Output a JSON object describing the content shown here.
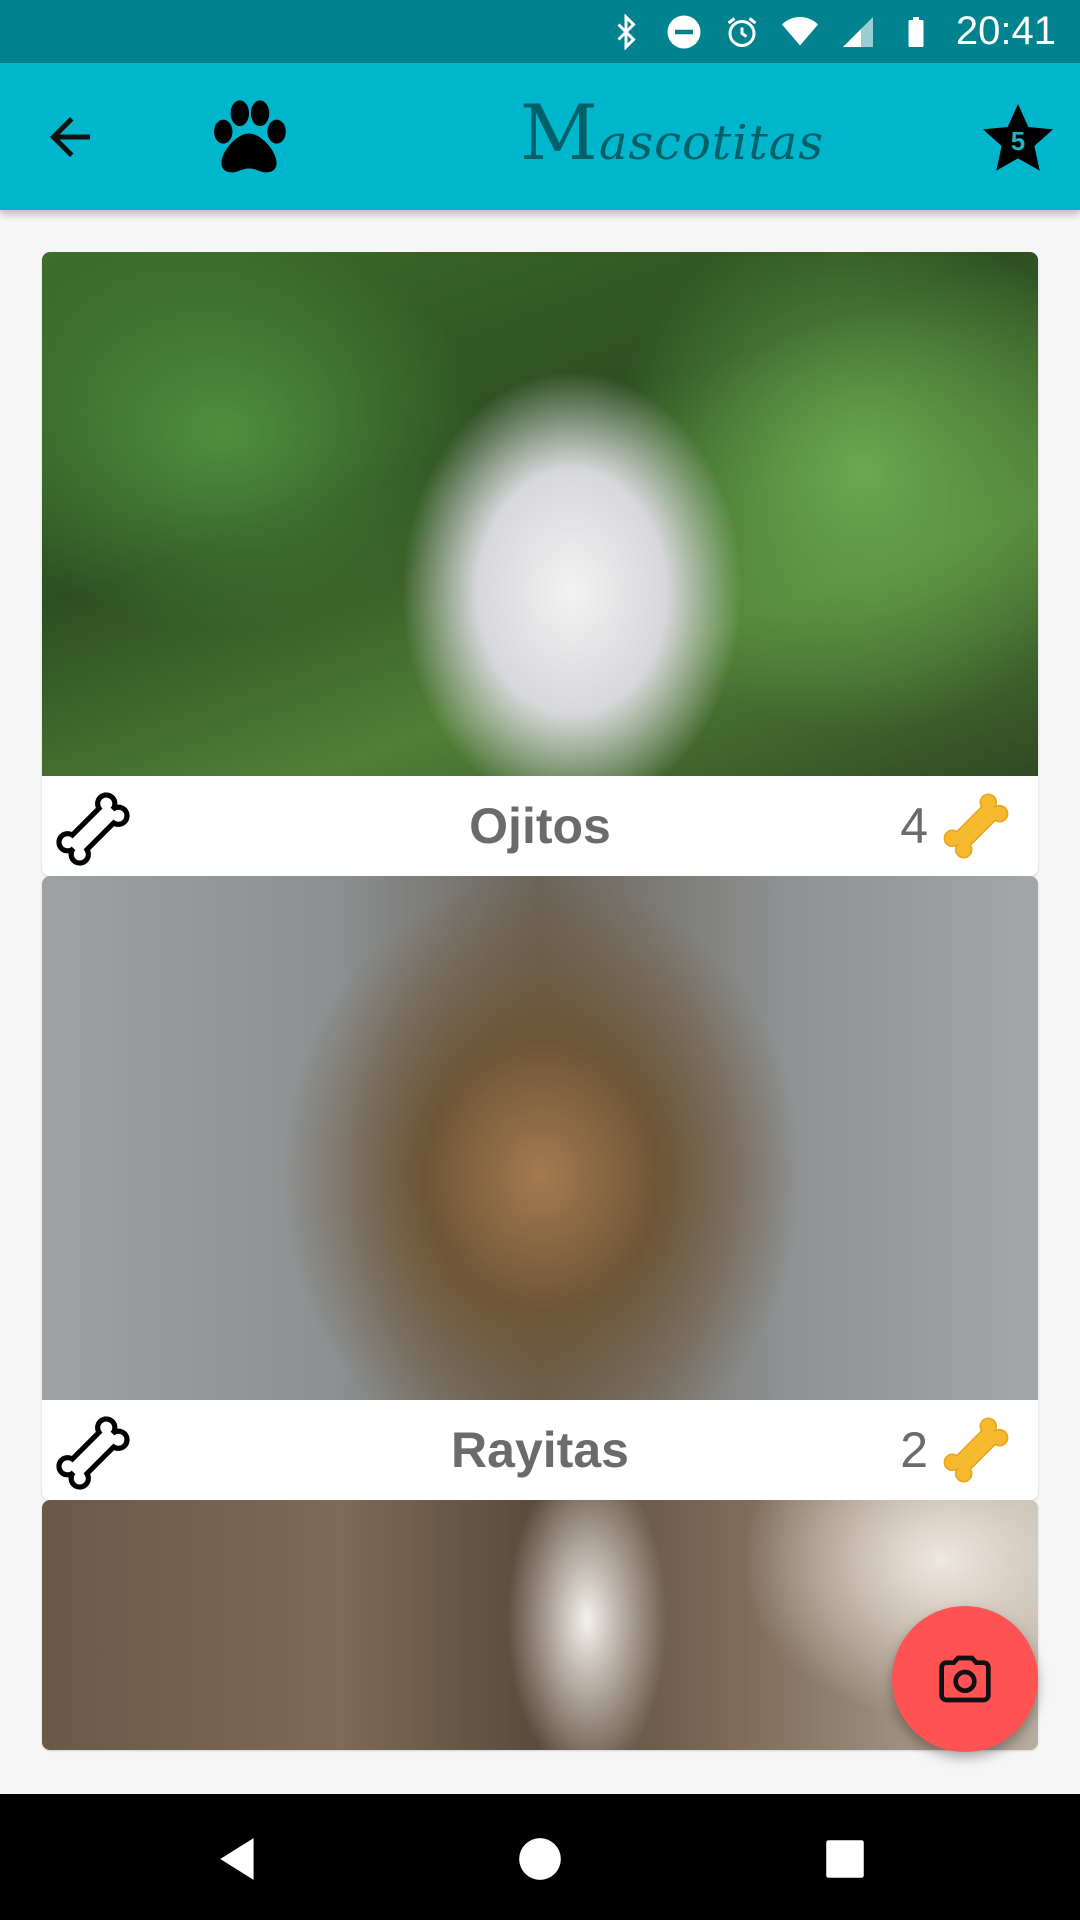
{
  "status_bar": {
    "time": "20:41",
    "icons": [
      "bluetooth-icon",
      "do-not-disturb-icon",
      "alarm-icon",
      "wifi-icon",
      "signal-icon",
      "battery-icon"
    ]
  },
  "app_bar": {
    "title_initial": "M",
    "title_rest": "ascotitas",
    "favorites_count": "5"
  },
  "pets": [
    {
      "name": "Ojitos",
      "likes": "4"
    },
    {
      "name": "Rayitas",
      "likes": "2"
    }
  ],
  "colors": {
    "status_bar": "#00838f",
    "app_bar": "#00b6cc",
    "fab": "#ff5252",
    "bone_gold": "#f5b82e"
  }
}
